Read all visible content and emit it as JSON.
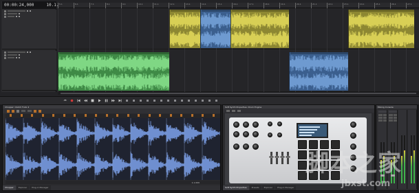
{
  "transport": {
    "time": "00:00:24,000",
    "measure": "10.1.000"
  },
  "ruler": {
    "labels": [
      "5.1",
      "6.1",
      "7.1",
      "8.1",
      "9.1",
      "10.1",
      "11.1",
      "12.1",
      "13.1",
      "14.1",
      "15.1",
      "16.1",
      "17.1",
      "18.1",
      "19.1",
      "20.1",
      "21.1",
      "22.1",
      "23.1",
      "24.1",
      "25.1",
      "26.1",
      "27.1"
    ]
  },
  "tracks": [
    {
      "id": 1,
      "color": "#b8b03c"
    },
    {
      "id": 2,
      "color": "#58b45c"
    }
  ],
  "colors": {
    "yellow_clip": "#b8b03c",
    "blue_clip": "#4f7fb8",
    "green_clip": "#58b45c",
    "chopper_wave": "#6f8fd0",
    "chop_marker": "#b8702a"
  },
  "transport_buttons": [
    "loop-icon",
    "record-icon",
    "go-start-icon",
    "rewind-icon",
    "stop-icon",
    "play-icon",
    "pause-icon",
    "fast-forward-icon",
    "go-end-icon"
  ],
  "chopper": {
    "title": "Chopper: Clutch Funk 4",
    "position": "1.1.000",
    "tabs": [
      {
        "label": "Chopper",
        "active": true
      },
      {
        "label": "Explorer",
        "active": false
      },
      {
        "label": "Plug-in Manager",
        "active": false
      }
    ]
  },
  "synth": {
    "title": "Soft Synth Properties: Drum Engine",
    "tabs": [
      {
        "label": "Soft Synth Properties",
        "active": true
      },
      {
        "label": "Presets",
        "active": false
      },
      {
        "label": "Explorer",
        "active": false
      },
      {
        "label": "Plug-in Manager",
        "active": false
      }
    ]
  },
  "mixer": {
    "title": "Mixing Console",
    "strips": [
      "Preview",
      "Master"
    ]
  },
  "watermark": {
    "chinese": "脚本之家",
    "url": "jbxst.com"
  }
}
